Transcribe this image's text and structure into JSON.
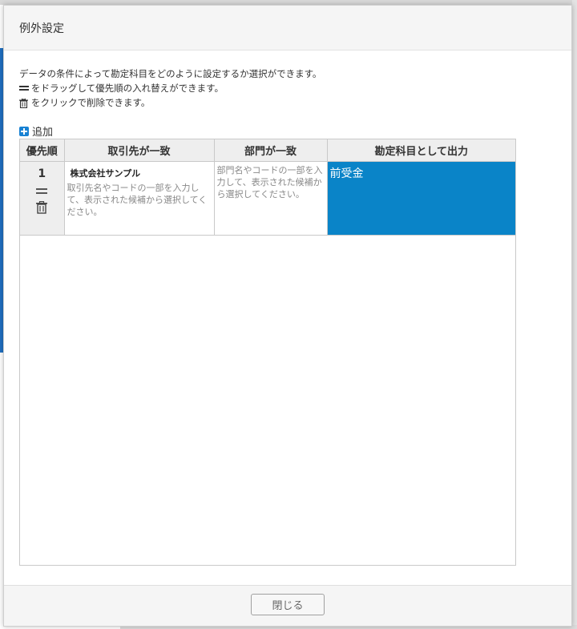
{
  "modal": {
    "title": "例外設定"
  },
  "description": {
    "line1": "データの条件によって勘定科目をどのように設定するか選択ができます。",
    "line2": "をドラッグして優先順の入れ替えができます。",
    "line3": "をクリックで削除できます。"
  },
  "add_label": "追加",
  "table": {
    "headers": [
      "優先順",
      "取引先が一致",
      "部門が一致",
      "勘定科目として出力"
    ],
    "rows": [
      {
        "priority": "1",
        "partner_name": "株式会社サンプル",
        "partner_placeholder": "取引先名やコードの一部を入力して、表示された候補から選択してください。",
        "dept_placeholder": "部門名やコードの一部を入力して、表示された候補から選択してください。",
        "account": "前受金"
      }
    ]
  },
  "footer": {
    "close_label": "閉じる"
  },
  "colors": {
    "accent": "#0a84c8",
    "add_icon": "#1781d3"
  }
}
